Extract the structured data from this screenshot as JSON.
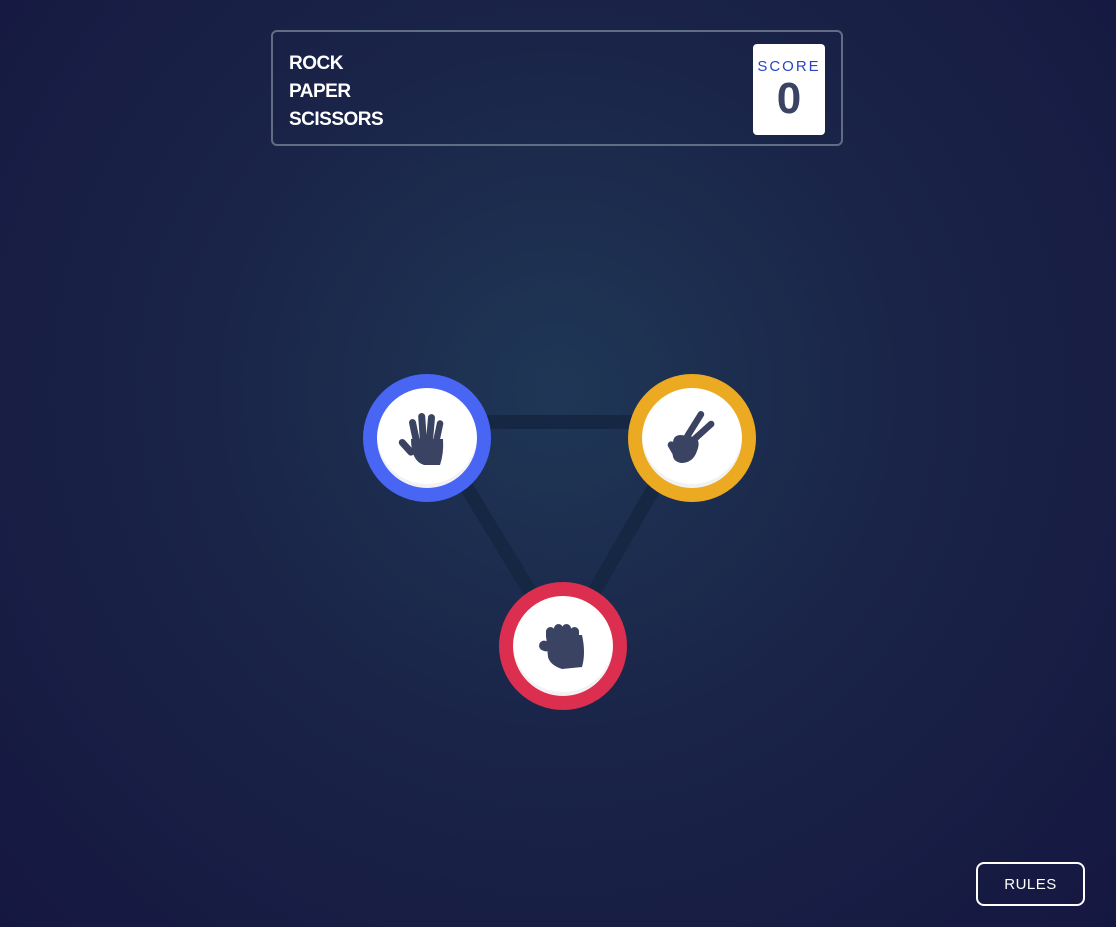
{
  "header": {
    "title_lines": [
      "ROCK",
      "PAPER",
      "SCISSORS"
    ],
    "score_label": "SCORE",
    "score_value": "0"
  },
  "choices": [
    {
      "name": "paper",
      "icon": "paper-hand-icon",
      "color": "#4865f4"
    },
    {
      "name": "scissors",
      "icon": "scissors-hand-icon",
      "color": "#eca922"
    },
    {
      "name": "rock",
      "icon": "rock-fist-icon",
      "color": "#dc2e4e"
    }
  ],
  "colors": {
    "background_center": "#1f3756",
    "background_edge": "#151740",
    "header_border": "#606e85",
    "score_label": "#2a46c0",
    "score_value": "#3b4363",
    "icon": "#3b4363"
  },
  "footer": {
    "rules_label": "RULES"
  }
}
